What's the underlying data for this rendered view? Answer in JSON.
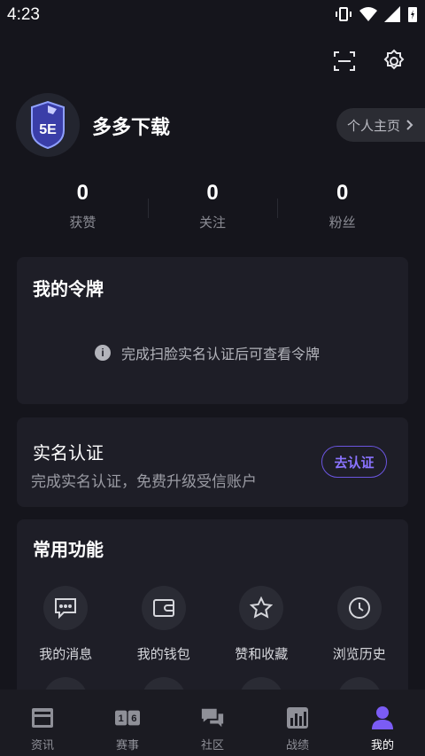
{
  "status_bar": {
    "time": "4:23"
  },
  "profile": {
    "username": "多多下载",
    "homepage_label": "个人主页",
    "avatar_alt": "5E"
  },
  "stats": [
    {
      "value": "0",
      "label": "获赞"
    },
    {
      "value": "0",
      "label": "关注"
    },
    {
      "value": "0",
      "label": "粉丝"
    }
  ],
  "token_card": {
    "title": "我的令牌",
    "message": "完成扫脸实名认证后可查看令牌"
  },
  "verify_card": {
    "title": "实名认证",
    "subtitle": "完成实名认证，免费升级受信账户",
    "button": "去认证"
  },
  "functions": {
    "title": "常用功能",
    "items": [
      {
        "label": "我的消息",
        "icon": "message-icon"
      },
      {
        "label": "我的钱包",
        "icon": "wallet-icon"
      },
      {
        "label": "赞和收藏",
        "icon": "star-icon"
      },
      {
        "label": "浏览历史",
        "icon": "clock-icon"
      }
    ]
  },
  "tabs": [
    {
      "label": "资讯",
      "icon": "news-icon",
      "active": false
    },
    {
      "label": "赛事",
      "icon": "match-icon",
      "active": false
    },
    {
      "label": "社区",
      "icon": "community-icon",
      "active": false
    },
    {
      "label": "战绩",
      "icon": "stats-icon",
      "active": false
    },
    {
      "label": "我的",
      "icon": "user-icon",
      "active": true
    }
  ],
  "colors": {
    "accent": "#6b55e0",
    "background": "#15151c",
    "card": "#1e1e27"
  }
}
